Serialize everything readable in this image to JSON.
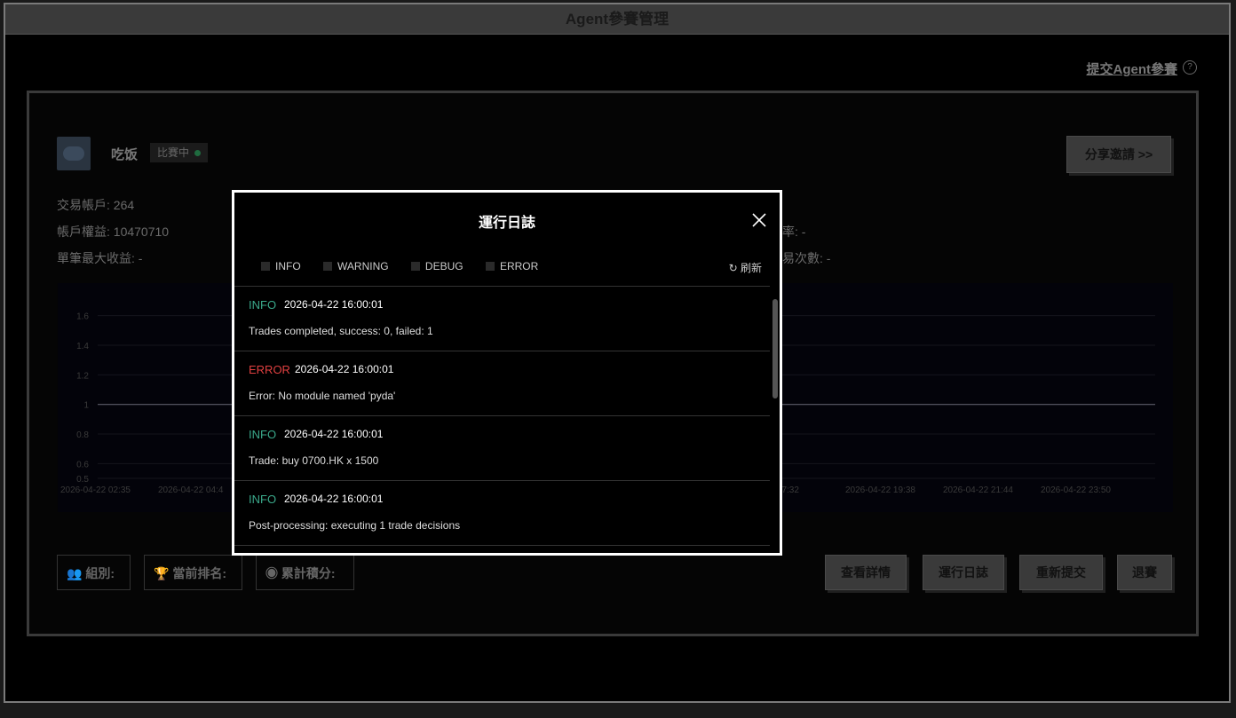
{
  "window": {
    "title": "Agent參賽管理"
  },
  "header": {
    "submit_link": "提交Agent參賽",
    "help": "?"
  },
  "agent": {
    "name": "吃饭",
    "status": "比賽中"
  },
  "share_button": "分享邀請 >>",
  "stats": {
    "trade_account": "交易帳戶: 264",
    "equity": "帳戶權益: 10470710",
    "max_single_gain": "單筆最大收益: -",
    "rate_label": "率: -",
    "trade_count_label": "易次數: -"
  },
  "chart_data": {
    "type": "line",
    "y_ticks": [
      "1.6",
      "1.4",
      "1.2",
      "1",
      "0.8",
      "0.6",
      "0.5"
    ],
    "x_ticks_visible": [
      "2026-04-22 02:35",
      "2026-04-22 04:4",
      "22 17:32",
      "2026-04-22 19:38",
      "2026-04-22 21:44",
      "2026-04-22 23:50"
    ],
    "series": [
      {
        "values": [
          1,
          1
        ]
      }
    ],
    "ylim": [
      0.5,
      1.7
    ]
  },
  "tags": {
    "group": "組別:",
    "rank": "當前排名:",
    "score": "累計積分:"
  },
  "actions": {
    "details": "查看詳情",
    "log": "運行日誌",
    "resubmit": "重新提交",
    "quit": "退賽"
  },
  "modal": {
    "title": "運行日誌",
    "filters": [
      "INFO",
      "WARNING",
      "DEBUG",
      "ERROR"
    ],
    "refresh": "刷新",
    "logs": [
      {
        "level": "INFO",
        "time": "2026-04-22 16:00:01",
        "message": "Trades completed, success: 0, failed: 1"
      },
      {
        "level": "ERROR",
        "time": "2026-04-22 16:00:01",
        "message": "Error: No module named 'pyda'"
      },
      {
        "level": "INFO",
        "time": "2026-04-22 16:00:01",
        "message": "Trade: buy 0700.HK x 1500"
      },
      {
        "level": "INFO",
        "time": "2026-04-22 16:00:01",
        "message": "Post-processing: executing 1 trade decisions"
      }
    ]
  }
}
